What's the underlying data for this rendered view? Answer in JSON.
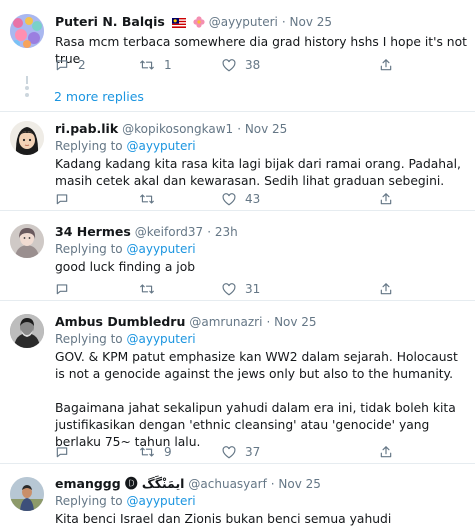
{
  "tweets": [
    {
      "name": "Puteri N. Balqis",
      "handle": "@ayyputeri",
      "date": "· Nov 25",
      "text": [
        "Rasa mcm terbaca somewhere dia grad history hshs I hope it's not true"
      ],
      "replies": "2",
      "retweets": "1",
      "likes": "38"
    },
    {
      "name": "ri.pab.lik",
      "handle": "@kopikosongkaw1",
      "date": "· Nov 25",
      "replying_label": "Replying to",
      "replying_to": "@ayyputeri",
      "text": [
        "Kadang kadang kita rasa kita lagi bijak dari ramai orang. Padahal, masih cetek akal dan kewarasan. Sedih lihat graduan sebegini."
      ],
      "replies": "",
      "retweets": "",
      "likes": "43"
    },
    {
      "name": "34 Hermes",
      "handle": "@keiford37",
      "date": "· 23h",
      "replying_label": "Replying to",
      "replying_to": "@ayyputeri",
      "text": [
        "good luck finding a job"
      ],
      "replies": "",
      "retweets": "",
      "likes": "31"
    },
    {
      "name": "Ambus Dumbledru",
      "handle": "@amrunazri",
      "date": "· Nov 25",
      "replying_label": "Replying to",
      "replying_to": "@ayyputeri",
      "text": [
        "GOV. & KPM patut emphasize kan WW2 dalam sejarah. Holocaust is not a genocide against the jews only but also to the humanity.",
        "Bagaimana jahat sekalipun yahudi dalam era ini, tidak boleh kita justifikasikan dengan 'ethnic cleansing' atau 'genocide' yang berlaku 75~ tahun lalu."
      ],
      "replies": "",
      "retweets": "9",
      "likes": "37"
    },
    {
      "name": "emanggg 🅓 ايمَنْگَگ",
      "handle": "@achuasyarf",
      "date": "· Nov 25",
      "replying_label": "Replying to",
      "replying_to": "@ayyputeri",
      "text": [
        "Kita benci Israel dan Zionis bukan benci semua yahudi"
      ],
      "replies": "",
      "retweets": "",
      "likes": ""
    }
  ],
  "more_replies": "2 more replies",
  "colors": {
    "link": "#1b95e0",
    "muted": "#657786",
    "border": "#e6ecf0"
  }
}
